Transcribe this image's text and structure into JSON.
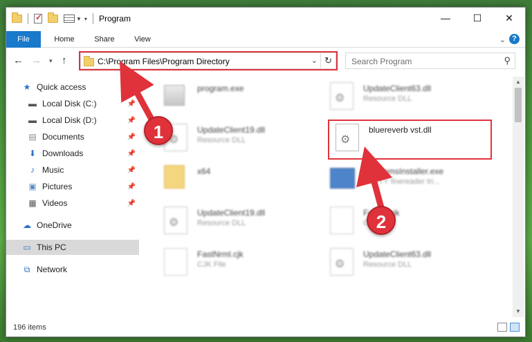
{
  "window": {
    "title": "Program",
    "controls": {
      "minimize": "—",
      "maximize": "☐",
      "close": "✕"
    }
  },
  "ribbon": {
    "tabs": [
      {
        "label": "File"
      },
      {
        "label": "Home"
      },
      {
        "label": "Share"
      },
      {
        "label": "View"
      }
    ],
    "help": "?"
  },
  "nav": {
    "address": "C:\\Program Files\\Program Directory",
    "search_placeholder": "Search Program"
  },
  "sidebar": {
    "items": [
      {
        "label": "Quick access",
        "icon": "star-icon"
      },
      {
        "label": "Local Disk (C:)",
        "icon": "drive-icon",
        "pinned": true
      },
      {
        "label": "Local Disk (D:)",
        "icon": "drive-icon",
        "pinned": true
      },
      {
        "label": "Documents",
        "icon": "documents-icon",
        "pinned": true
      },
      {
        "label": "Downloads",
        "icon": "download-icon",
        "pinned": true
      },
      {
        "label": "Music",
        "icon": "music-icon",
        "pinned": true
      },
      {
        "label": "Pictures",
        "icon": "pictures-icon",
        "pinned": true
      },
      {
        "label": "Videos",
        "icon": "videos-icon",
        "pinned": true
      },
      {
        "label": "OneDrive",
        "icon": "cloud-icon"
      },
      {
        "label": "This PC",
        "icon": "computer-icon",
        "selected": true
      },
      {
        "label": "Network",
        "icon": "network-icon"
      }
    ]
  },
  "files": [
    {
      "name": "program.exe",
      "type": ""
    },
    {
      "name": "UpdateClient63.dll",
      "type": "Resource DLL"
    },
    {
      "name": "UpdateClient19.dll",
      "type": "Resource DLL"
    },
    {
      "name": "bluereverb vst.dll",
      "type": ""
    },
    {
      "name": "x64",
      "type": ""
    },
    {
      "name": "ProgramsInstaller.exe",
      "type": "ABBYY finereader tri..."
    },
    {
      "name": "UpdateClient19.dll",
      "type": "Resource DLL"
    },
    {
      "name": "Fe...rn.cjk",
      "type": "C..."
    },
    {
      "name": "FastNrml.cjk",
      "type": "CJK File"
    },
    {
      "name": "UpdateClient63.dll",
      "type": "Resource DLL"
    }
  ],
  "status": {
    "count": "196 items"
  },
  "annotations": {
    "step1": "1",
    "step2": "2"
  },
  "colors": {
    "accent": "#1979ca",
    "highlight": "#e0323b"
  }
}
